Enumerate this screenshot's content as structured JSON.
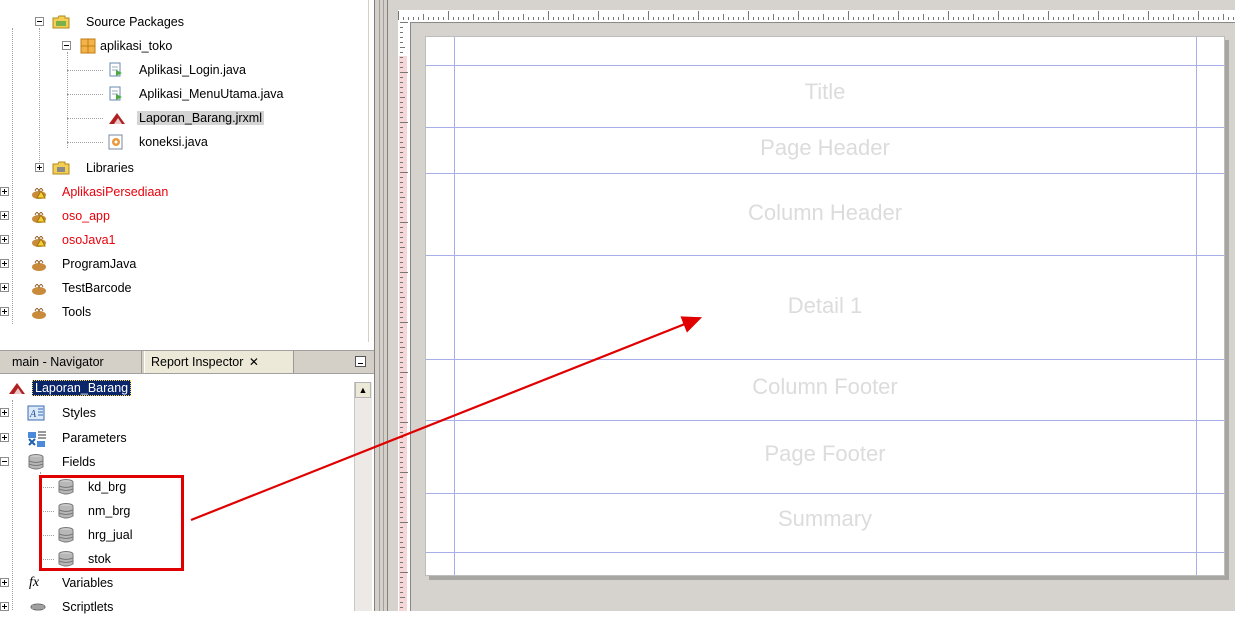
{
  "project_tree": {
    "source_packages": "Source Packages",
    "package": "aplikasi_toko",
    "files": [
      "Aplikasi_Login.java",
      "Aplikasi_MenuUtama.java",
      "Laporan_Barang.jrxml",
      "koneksi.java"
    ],
    "libraries": "Libraries",
    "projects": [
      {
        "name": "AplikasiPersediaan",
        "error": true
      },
      {
        "name": "oso_app",
        "error": true
      },
      {
        "name": "osoJava1",
        "error": true
      },
      {
        "name": "ProgramJava",
        "error": false
      },
      {
        "name": "TestBarcode",
        "error": false
      },
      {
        "name": "Tools",
        "error": false
      }
    ]
  },
  "inspector": {
    "tab_navigator": "main - Navigator",
    "tab_report_inspector": "Report Inspector",
    "tab_close": "✕",
    "root": "Laporan_Barang",
    "nodes": {
      "styles": "Styles",
      "parameters": "Parameters",
      "fields": "Fields",
      "variables": "Variables",
      "scriptlets": "Scriptlets"
    },
    "fields": [
      "kd_brg",
      "nm_brg",
      "hrg_jual",
      "stok"
    ]
  },
  "designer": {
    "bands": [
      "Title",
      "Page Header",
      "Column Header",
      "Detail 1",
      "Column Footer",
      "Page Footer",
      "Summary"
    ]
  },
  "colors": {
    "error_project": "#e8000b",
    "annotation": "#e00000",
    "band_line": "#a8aee8",
    "selection": "#0a246a"
  }
}
